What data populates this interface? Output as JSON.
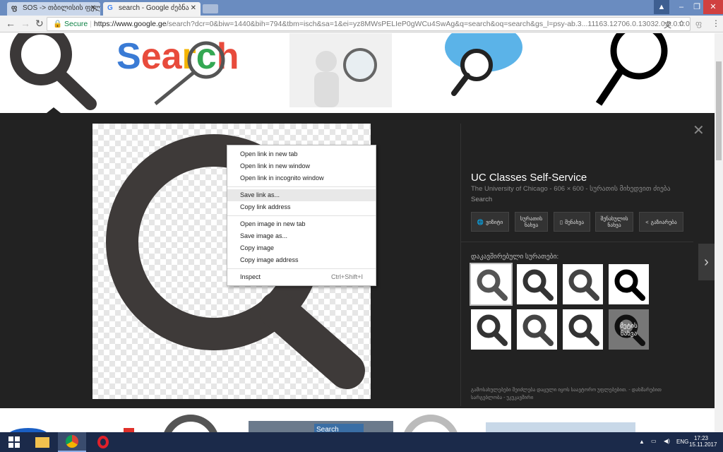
{
  "browser": {
    "tabs": [
      {
        "label": "SOS -> თბილისის ფელ",
        "icon": "tbilisi-icon",
        "active": false
      },
      {
        "label": "search - Google ძებნა",
        "icon": "google-icon",
        "active": true
      }
    ],
    "secure_label": "Secure",
    "url_host": "https://www.google.ge",
    "url_path": "/search?dcr=0&biw=1440&bih=794&tbm=isch&sa=1&ei=yz8MWsPELIeP0gWCu4SwAg&q=search&oq=search&gs_l=psy-ab.3...11163.12706.0.13032.0.0.0.0.0.0...."
  },
  "context_menu": {
    "items": [
      {
        "label": "Open link in new tab",
        "group": 1
      },
      {
        "label": "Open link in new window",
        "group": 1
      },
      {
        "label": "Open link in incognito window",
        "group": 1
      },
      {
        "label": "Save link as...",
        "group": 2,
        "highlighted": true
      },
      {
        "label": "Copy link address",
        "group": 2
      },
      {
        "label": "Open image in new tab",
        "group": 3
      },
      {
        "label": "Save image as...",
        "group": 3
      },
      {
        "label": "Copy image",
        "group": 3
      },
      {
        "label": "Copy image address",
        "group": 3
      },
      {
        "label": "Inspect",
        "shortcut": "Ctrl+Shift+I",
        "group": 4
      }
    ]
  },
  "info": {
    "title": "UC Classes Self-Service",
    "meta": "The University of Chicago - 606 × 600 - სურათის მიხედვით ძიება",
    "search": "Search",
    "buttons": [
      "ვიზიტი",
      "სურათის ნახვა",
      "შენახვა",
      "შენახულის ნახვა",
      "გაზიარება"
    ],
    "related_label": "დაკავშირებული სურათები:",
    "more_label": "მეტის ნახვა",
    "footer": "გამოსახულებები შეიძლება დაცული იყოს საავტორო უფლებებით. - დახმარებით სარგებლობა - უკუკავშირი"
  },
  "taskbar": {
    "language": "ENG",
    "time": "17:23",
    "date": "15.11.2017"
  }
}
